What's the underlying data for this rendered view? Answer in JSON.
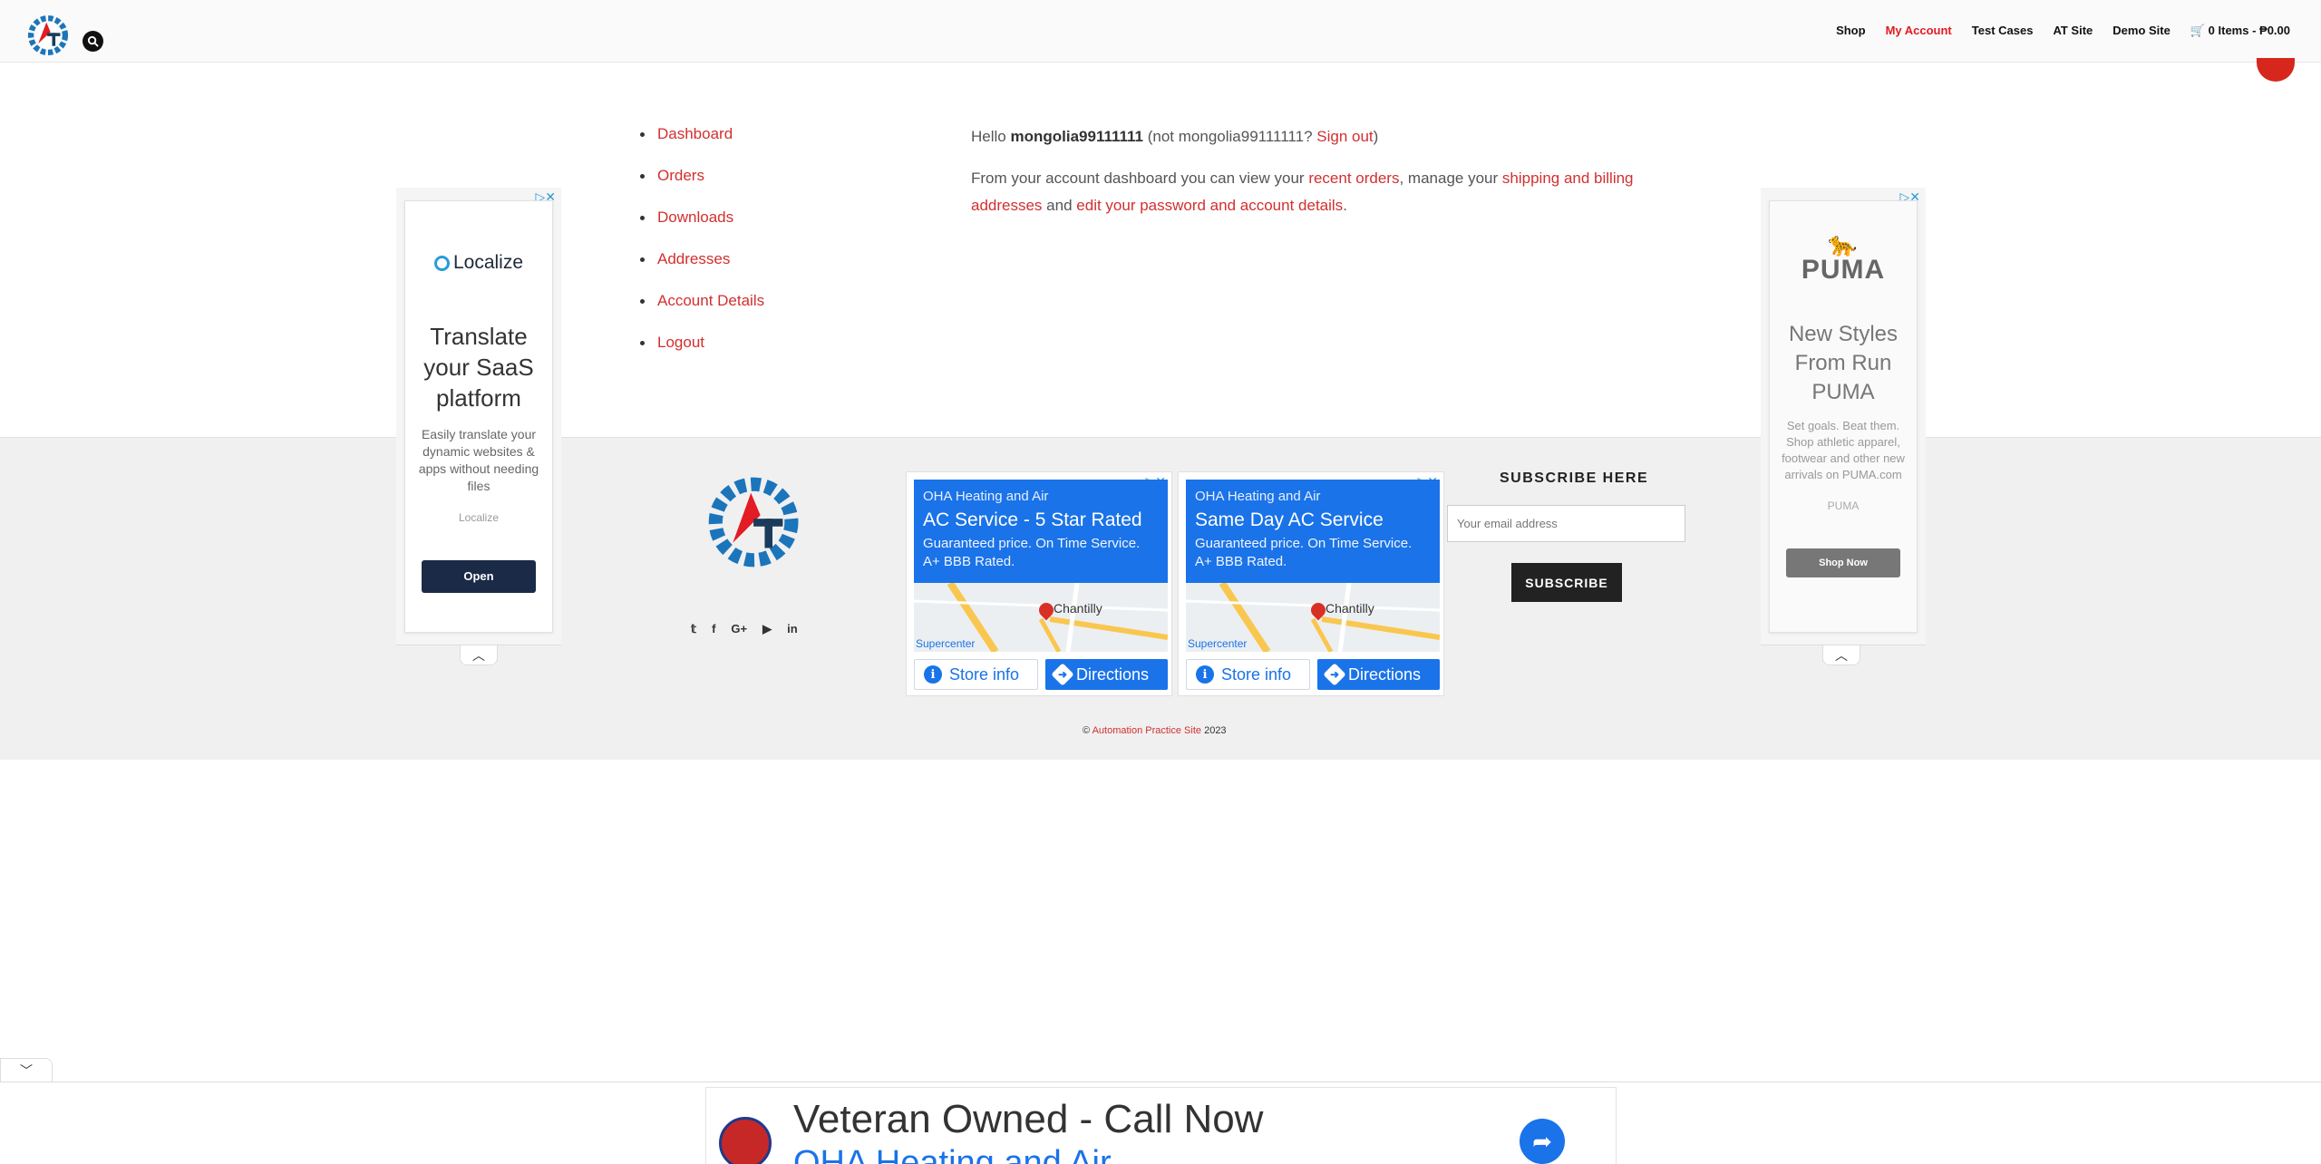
{
  "header": {
    "nav": [
      {
        "label": "Shop"
      },
      {
        "label": "My Account"
      },
      {
        "label": "Test Cases"
      },
      {
        "label": "AT Site"
      },
      {
        "label": "Demo Site"
      },
      {
        "label": "0 Items - ₱0.00"
      }
    ]
  },
  "account_nav": [
    {
      "label": "Dashboard"
    },
    {
      "label": "Orders"
    },
    {
      "label": "Downloads"
    },
    {
      "label": "Addresses"
    },
    {
      "label": "Account Details"
    },
    {
      "label": "Logout"
    }
  ],
  "dashboard": {
    "hello": "Hello",
    "username": "mongolia99111111",
    "not_text": "(not mongolia99111111?",
    "sign_out": "Sign out",
    "close_paren": ")",
    "intro": "From your account dashboard you can view your",
    "recent_orders": "recent orders",
    "manage": ", manage your",
    "shipping": "shipping and billing addresses",
    "and": "and",
    "edit_password": "edit your password and account details",
    "period": "."
  },
  "ad_left": {
    "brand": "Localize",
    "headline": "Translate your SaaS platform",
    "body": "Easily translate your dynamic websites & apps without needing files",
    "advertiser": "Localize",
    "cta": "Open"
  },
  "ad_right": {
    "brand": "PUMA",
    "headline": "New Styles From Run PUMA",
    "body": "Set goals. Beat them. Shop athletic apparel, footwear and other new arrivals on PUMA.com",
    "advertiser": "PUMA",
    "cta": "Shop Now"
  },
  "map_ads": [
    {
      "business": "OHA Heating and Air",
      "headline": "AC Service - 5 Star Rated",
      "desc": "Guaranteed price. On Time Service. A+ BBB Rated.",
      "place": "Chantilly",
      "place_label": "Supercenter",
      "store_info": "Store info",
      "directions": "Directions"
    },
    {
      "business": "OHA Heating and Air",
      "headline": "Same Day AC Service",
      "desc": "Guaranteed price. On Time Service. A+ BBB Rated.",
      "place": "Chantilly",
      "place_label": "Supercenter",
      "store_info": "Store info",
      "directions": "Directions"
    }
  ],
  "subscribe": {
    "title": "SUBSCRIBE HERE",
    "placeholder": "Your email address",
    "button": "SUBSCRIBE"
  },
  "social_icons": [
    "twitter-icon",
    "facebook-icon",
    "google-plus-icon",
    "youtube-icon",
    "linkedin-icon"
  ],
  "copyright": {
    "symbol": "©",
    "site": "Automation Practice Site",
    "year": "2023"
  },
  "bottom_ad": {
    "headline": "Veteran Owned - Call Now",
    "sub": "OHA Heating and Air"
  },
  "colors": {
    "accent": "#e31b23",
    "link": "#d32f2f",
    "logo_blue": "#1b75bb",
    "map_blue": "#1a73e8"
  }
}
